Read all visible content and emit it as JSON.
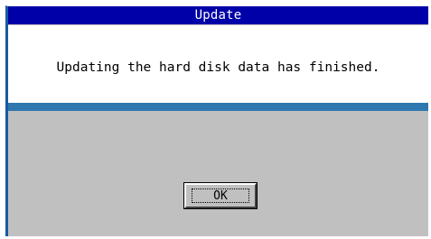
{
  "window": {
    "title": "Update"
  },
  "message": {
    "text": "Updating the hard disk data has finished."
  },
  "buttons": {
    "ok_label": "OK"
  },
  "colors": {
    "titlebar": "#0000a8",
    "title_text": "#ffffff",
    "dialog_background": "#c0c0c0",
    "message_panel": "#ffffff",
    "accent_bar": "#2e78b0"
  }
}
